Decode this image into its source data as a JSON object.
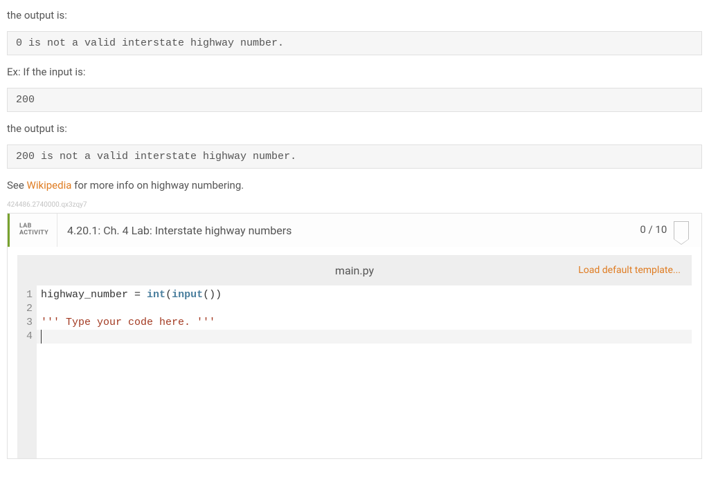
{
  "prompt": {
    "output_label1": "the output is:",
    "output_block1": "0 is not a valid interstate highway number.",
    "input_label": "Ex: If the input is:",
    "input_block": "200",
    "output_label2": "the output is:",
    "output_block2": "200 is not a valid interstate highway number.",
    "see_text_before": "See ",
    "see_link": "Wikipedia",
    "see_text_after": " for more info on highway numbering.",
    "meta_id": "424486.2740000.qx3zqy7"
  },
  "lab": {
    "activity_line1": "LAB",
    "activity_line2": "ACTIVITY",
    "title": "4.20.1: Ch. 4 Lab: Interstate highway numbers",
    "score": "0 / 10"
  },
  "editor": {
    "filename": "main.py",
    "load_template": "Load default template...",
    "gutter": [
      "1",
      "2",
      "3",
      "4"
    ],
    "line1": {
      "a": "highway_number",
      "b": " = ",
      "c": "int",
      "d": "(",
      "e": "input",
      "f": "())"
    },
    "line2": "",
    "line3": "''' Type your code here. '''",
    "line4": ""
  }
}
